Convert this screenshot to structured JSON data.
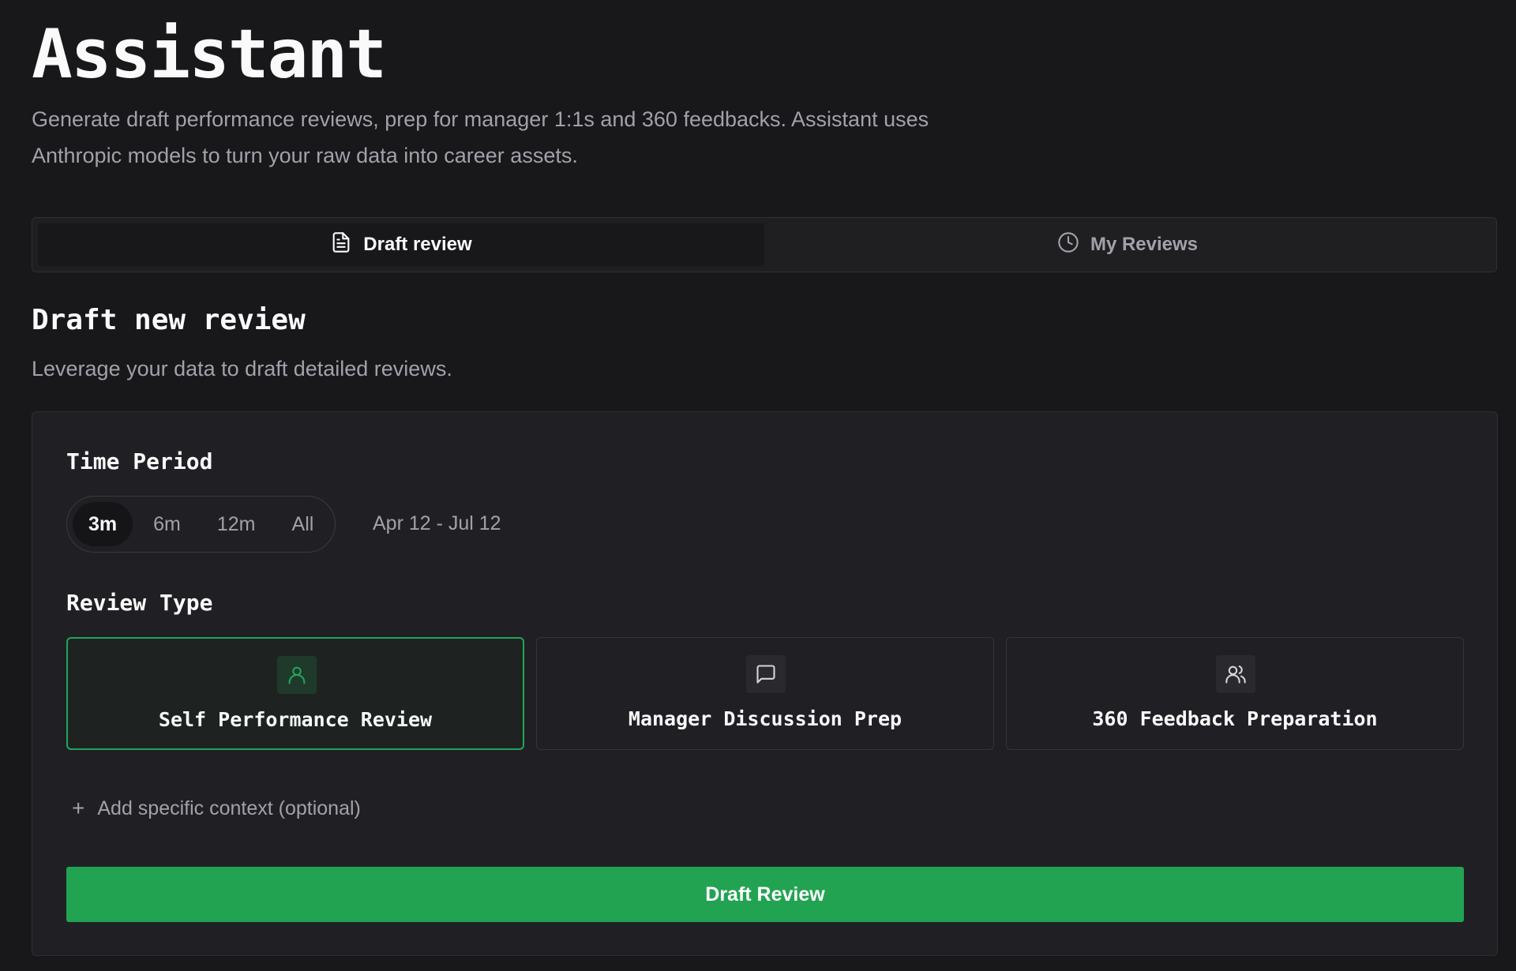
{
  "page": {
    "title": "Assistant",
    "subtitle": "Generate draft performance reviews, prep for manager 1:1s and 360 feedbacks. Assistant uses Anthropic models to turn your raw data into career assets."
  },
  "tabs": [
    {
      "label": "Draft review",
      "icon": "document-icon",
      "active": true
    },
    {
      "label": "My Reviews",
      "icon": "clock-icon",
      "active": false
    }
  ],
  "section": {
    "title": "Draft new review",
    "subtitle": "Leverage your data to draft detailed reviews."
  },
  "time_period": {
    "label": "Time Period",
    "options": [
      "3m",
      "6m",
      "12m",
      "All"
    ],
    "selected": "3m",
    "range": "Apr 12 - Jul 12"
  },
  "review_type": {
    "label": "Review Type",
    "options": [
      {
        "label": "Self Performance Review",
        "icon": "user-icon",
        "selected": true
      },
      {
        "label": "Manager Discussion Prep",
        "icon": "message-square-icon",
        "selected": false
      },
      {
        "label": "360 Feedback Preparation",
        "icon": "users-icon",
        "selected": false
      }
    ]
  },
  "context": {
    "label": "Add specific context (optional)"
  },
  "actions": {
    "draft": "Draft Review"
  },
  "colors": {
    "accent": "#22a352",
    "background": "#18181b",
    "muted_text": "#a1a1aa"
  }
}
